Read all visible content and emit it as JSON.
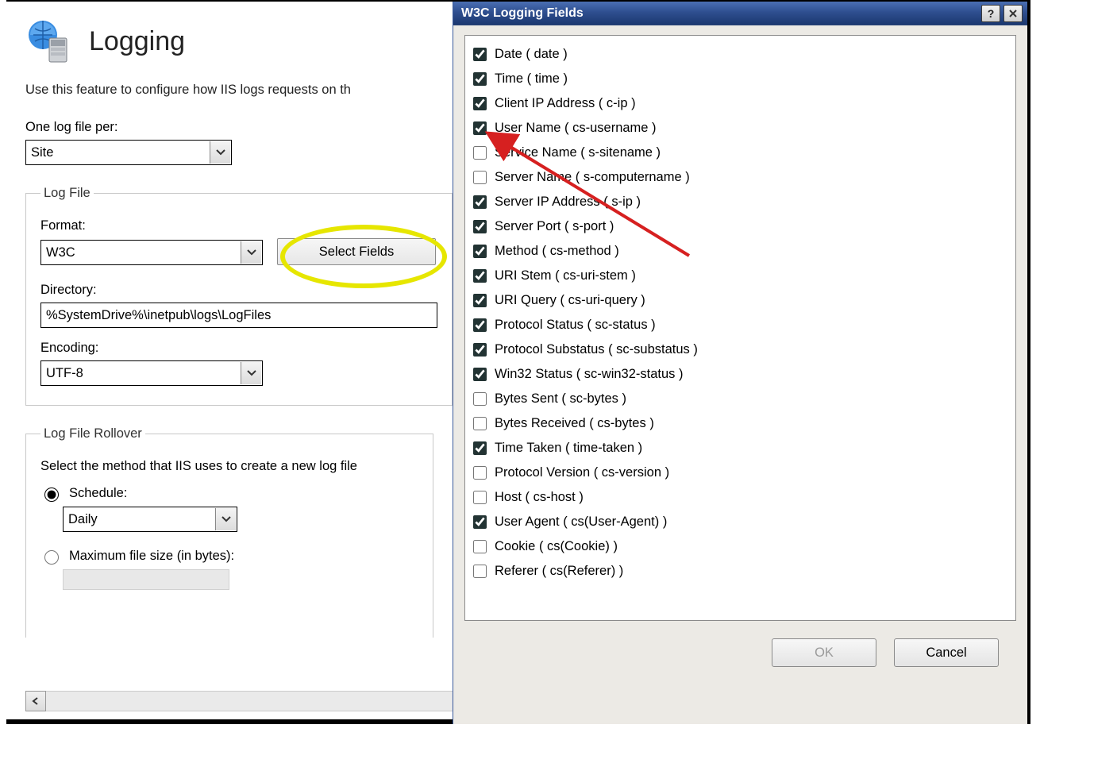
{
  "page": {
    "title": "Logging",
    "description": "Use this feature to configure how IIS logs requests on th",
    "one_log_file_per_label": "One log file per:",
    "one_log_file_per_value": "Site"
  },
  "log_file": {
    "legend": "Log File",
    "format_label": "Format:",
    "format_value": "W3C",
    "select_fields_button": "Select Fields",
    "directory_label": "Directory:",
    "directory_value": "%SystemDrive%\\inetpub\\logs\\LogFiles",
    "encoding_label": "Encoding:",
    "encoding_value": "UTF-8"
  },
  "rollover": {
    "legend": "Log File Rollover",
    "description": "Select the method that IIS uses to create a new log file",
    "schedule_label": "Schedule:",
    "schedule_value": "Daily",
    "max_file_size_label": "Maximum file size (in bytes):",
    "selected": "schedule"
  },
  "dialog": {
    "title": "W3C Logging Fields",
    "ok_label": "OK",
    "cancel_label": "Cancel",
    "fields": [
      {
        "label": "Date ( date )",
        "checked": true
      },
      {
        "label": "Time ( time )",
        "checked": true
      },
      {
        "label": "Client IP Address ( c-ip )",
        "checked": true
      },
      {
        "label": "User Name ( cs-username )",
        "checked": true
      },
      {
        "label": "Service Name ( s-sitename )",
        "checked": false
      },
      {
        "label": "Server Name ( s-computername )",
        "checked": false
      },
      {
        "label": "Server IP Address ( s-ip )",
        "checked": true
      },
      {
        "label": "Server Port ( s-port )",
        "checked": true
      },
      {
        "label": "Method ( cs-method )",
        "checked": true
      },
      {
        "label": "URI Stem ( cs-uri-stem )",
        "checked": true
      },
      {
        "label": "URI Query ( cs-uri-query )",
        "checked": true
      },
      {
        "label": "Protocol Status ( sc-status )",
        "checked": true
      },
      {
        "label": "Protocol Substatus ( sc-substatus )",
        "checked": true
      },
      {
        "label": "Win32 Status ( sc-win32-status )",
        "checked": true
      },
      {
        "label": "Bytes Sent ( sc-bytes )",
        "checked": false
      },
      {
        "label": "Bytes Received ( cs-bytes )",
        "checked": false
      },
      {
        "label": "Time Taken ( time-taken )",
        "checked": true
      },
      {
        "label": "Protocol Version ( cs-version )",
        "checked": false
      },
      {
        "label": "Host ( cs-host )",
        "checked": false
      },
      {
        "label": "User Agent ( cs(User-Agent) )",
        "checked": true
      },
      {
        "label": "Cookie ( cs(Cookie) )",
        "checked": false
      },
      {
        "label": "Referer ( cs(Referer) )",
        "checked": false
      }
    ]
  }
}
